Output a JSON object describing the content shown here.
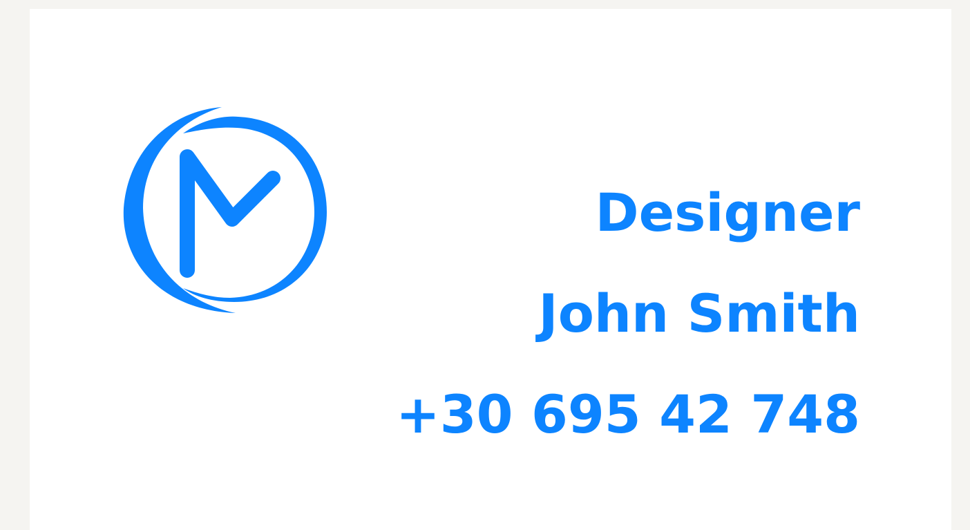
{
  "brand": {
    "logo_icon": "m-monogram-circle-icon",
    "accent_color": "#0d84ff"
  },
  "card": {
    "role": "Designer",
    "name": "John Smith",
    "phone": "+30 695 42 748"
  }
}
